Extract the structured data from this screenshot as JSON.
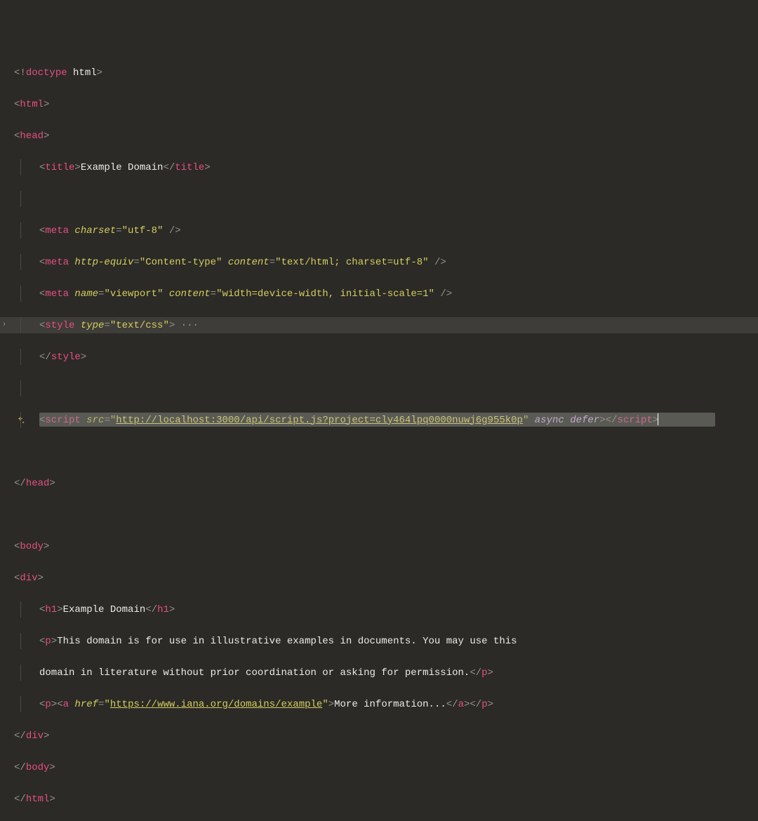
{
  "code": {
    "doctype": {
      "open": "<!",
      "kw": "doctype",
      "arg": "html",
      "close": ">"
    },
    "html_open": "html",
    "head_open": "head",
    "title": {
      "tag": "title",
      "text": "Example Domain"
    },
    "meta1": {
      "tag": "meta",
      "attr1": "charset",
      "val1": "\"utf-8\""
    },
    "meta2": {
      "tag": "meta",
      "attr1": "http-equiv",
      "val1": "\"Content-type\"",
      "attr2": "content",
      "val2": "\"text/html; charset=utf-8\""
    },
    "meta3": {
      "tag": "meta",
      "attr1": "name",
      "val1": "\"viewport\"",
      "attr2": "content",
      "val2": "\"width=device-width, initial-scale=1\""
    },
    "style_open": {
      "tag": "style",
      "attr": "type",
      "val": "\"text/css\""
    },
    "style_close": "style",
    "script": {
      "tag": "script",
      "attr_src": "src",
      "val_src_q": "\"",
      "val_src_url": "http://localhost:3000/api/script.js?project=cly464lpq0000nuwj6g955k0p",
      "kw1": "async",
      "kw2": "defer"
    },
    "head_close": "head",
    "body_open": "body",
    "div_open": "div",
    "h1": {
      "tag": "h1",
      "text": "Example Domain"
    },
    "p1": {
      "tag": "p",
      "line1": "This domain is for use in illustrative examples in documents. You may use this",
      "line2": "domain in literature without prior coordination or asking for permission."
    },
    "p2": {
      "tag": "p",
      "atag": "a",
      "attr": "href",
      "val_q": "\"",
      "val_url": "https://www.iana.org/domains/example",
      "text": "More information..."
    },
    "div_close": "div",
    "body_close": "body",
    "html_close": "html",
    "fold": "···"
  }
}
